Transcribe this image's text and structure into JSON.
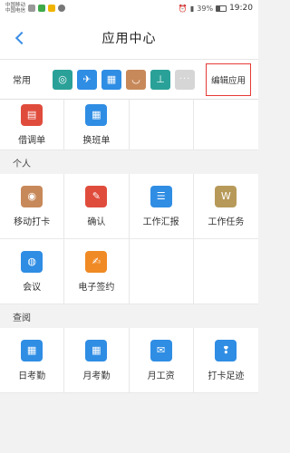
{
  "status": {
    "carrier1": "中国移动",
    "carrier2": "中国电信",
    "battery_text": "39%",
    "battery_level": 0.39,
    "time": "19:20"
  },
  "nav": {
    "title": "应用中心"
  },
  "common": {
    "label": "常用",
    "edit_label": "编辑应用",
    "icons": [
      {
        "icon": "chat-icon",
        "color": "#2aa198"
      },
      {
        "icon": "plane-icon",
        "color": "#2f8de4"
      },
      {
        "icon": "calendar-icon",
        "color": "#2f8de4"
      },
      {
        "icon": "cup-icon",
        "color": "#c8895a"
      },
      {
        "icon": "stamp-icon",
        "color": "#2aa198"
      },
      {
        "icon": "more-icon",
        "color": "#d6d6d6"
      }
    ]
  },
  "top_apps": [
    {
      "label": "借调单",
      "icon": "id-card-icon"
    },
    {
      "label": "换班单",
      "icon": "schedule-icon"
    }
  ],
  "sections": [
    {
      "title": "个人",
      "apps": [
        {
          "label": "移动打卡",
          "icon": "location-pin-icon"
        },
        {
          "label": "确认",
          "icon": "confirm-icon"
        },
        {
          "label": "工作汇报",
          "icon": "report-icon"
        },
        {
          "label": "工作任务",
          "icon": "task-icon"
        },
        {
          "label": "会议",
          "icon": "meeting-icon"
        },
        {
          "label": "电子签约",
          "icon": "e-sign-icon"
        }
      ]
    },
    {
      "title": "查阅",
      "apps": [
        {
          "label": "日考勤",
          "icon": "calendar-day-icon"
        },
        {
          "label": "月考勤",
          "icon": "calendar-month-icon"
        },
        {
          "label": "月工资",
          "icon": "salary-icon"
        },
        {
          "label": "打卡足迹",
          "icon": "footprint-icon"
        }
      ]
    }
  ]
}
